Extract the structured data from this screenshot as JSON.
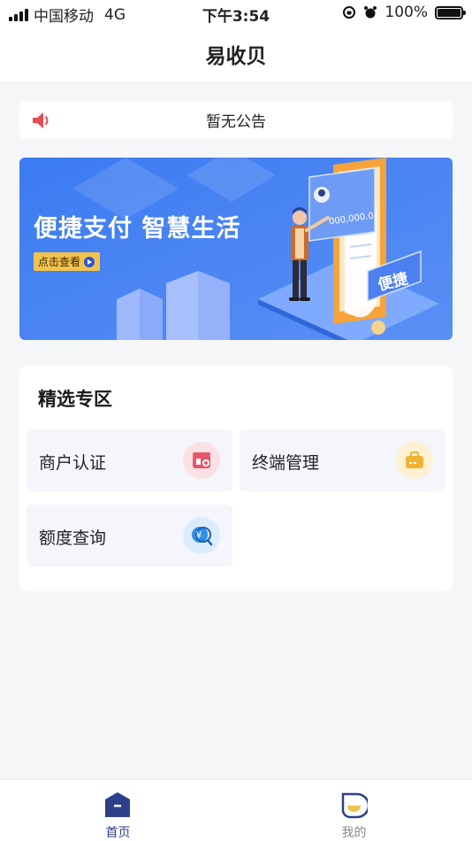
{
  "status_bar": {
    "carrier": "中国移动",
    "network": "4G",
    "time": "下午3:54",
    "battery": "100%"
  },
  "header": {
    "title": "易收贝"
  },
  "notice": {
    "icon": "speaker-icon",
    "text": "暂无公告"
  },
  "banner": {
    "headline": "便捷支付 智慧生活",
    "cta_label": "点击查看",
    "card_amount": "000,000.0",
    "stamp_text": "便捷"
  },
  "featured": {
    "title": "精选专区",
    "items": [
      {
        "label": "商户认证",
        "icon": "merchant-store-icon",
        "color": "#e8566b"
      },
      {
        "label": "终端管理",
        "icon": "terminal-briefcase-icon",
        "color": "#f2b233"
      },
      {
        "label": "额度查询",
        "icon": "quota-search-icon",
        "color": "#2f8fe6"
      }
    ]
  },
  "tabbar": {
    "tabs": [
      {
        "label": "首页",
        "icon": "home-icon",
        "active": true
      },
      {
        "label": "我的",
        "icon": "profile-icon",
        "active": false
      }
    ]
  },
  "colors": {
    "brand_navy": "#2d3f8a",
    "banner_blue": "#3f7bf0",
    "cta_yellow": "#f3c24d",
    "notice_red": "#e94d4d"
  }
}
